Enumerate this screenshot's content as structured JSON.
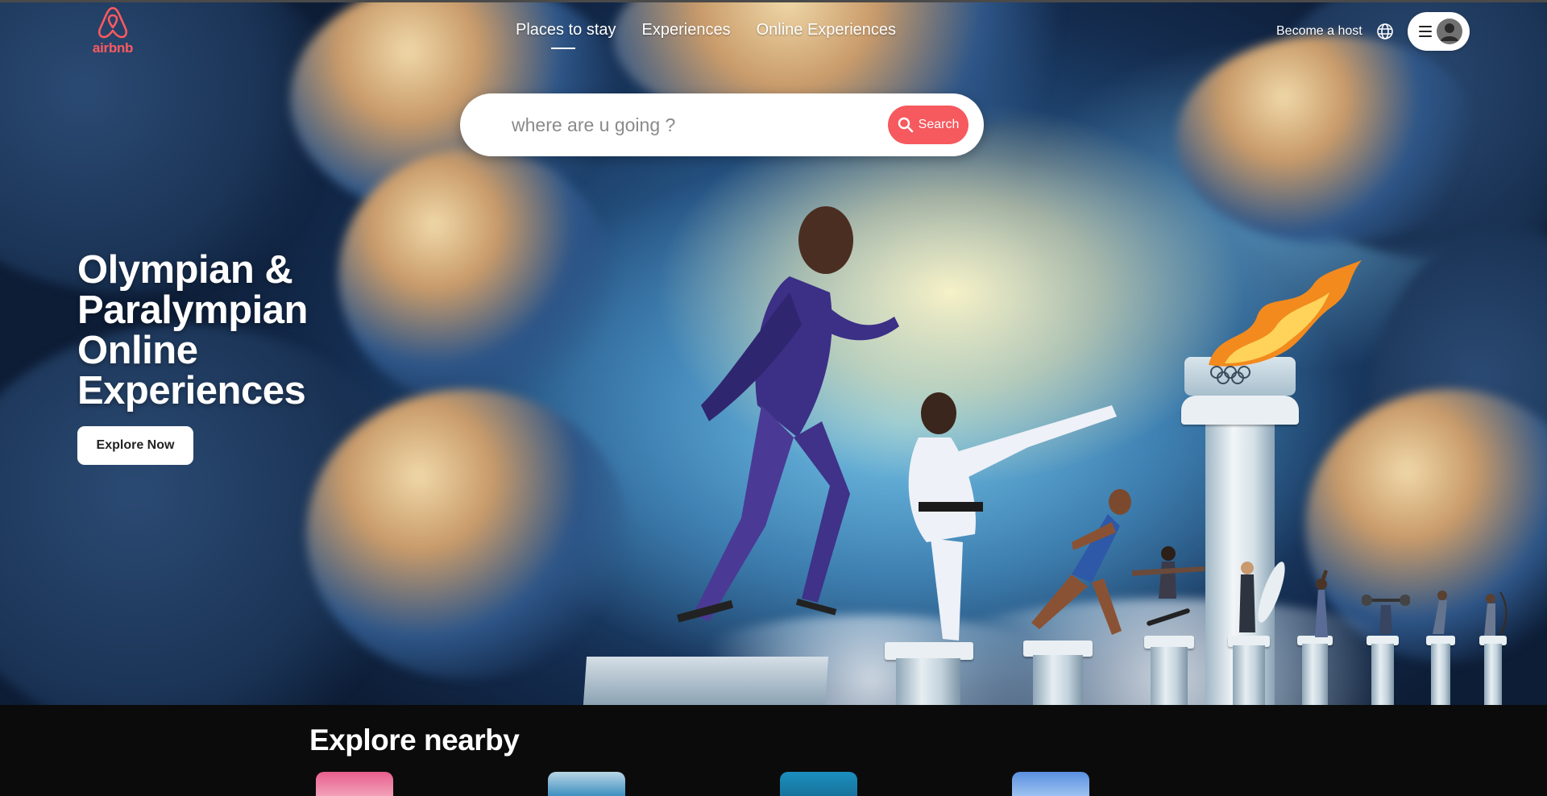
{
  "brand": {
    "name": "airbnb",
    "accent": "#ff5a5f"
  },
  "nav": {
    "tabs": [
      {
        "label": "Places to stay",
        "active": true
      },
      {
        "label": "Experiences",
        "active": false
      },
      {
        "label": "Online Experiences",
        "active": false
      }
    ],
    "become_host": "Become a host",
    "globe_icon": "globe-icon",
    "menu_icon": "hamburger-icon",
    "avatar_icon": "user-avatar-icon"
  },
  "search": {
    "placeholder": "where are u going ?",
    "button_label": "Search",
    "button_color": "#f6595e"
  },
  "hero": {
    "title": "Olympian &\nParalympian\nOnline\nExperiences",
    "cta": "Explore Now"
  },
  "nearby": {
    "heading": "Explore nearby",
    "thumb_colors": [
      "#e06a9a",
      "#4a9cc4",
      "#1d86b5",
      "#3f7fd6"
    ]
  }
}
